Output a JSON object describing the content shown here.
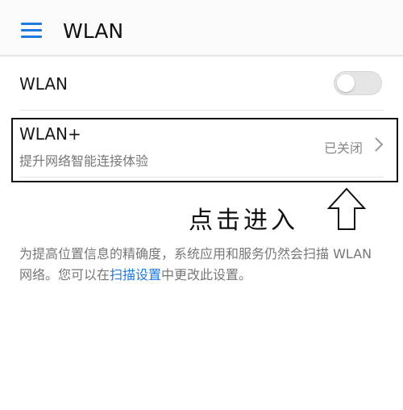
{
  "header": {
    "title": "WLAN",
    "menu_icon": "hamburger-menu-icon",
    "accent_color": "#1f7ae0"
  },
  "wlan_row": {
    "label": "WLAN",
    "toggle_state": "off"
  },
  "wlan_plus_row": {
    "title": "WLAN+",
    "subtitle": "提升网络智能连接体验",
    "status": "已关闭",
    "chevron_icon": "chevron-right-icon"
  },
  "annotation": {
    "text": "点击进入",
    "arrow_icon": "up-arrow-icon"
  },
  "info": {
    "text_before": "为提高位置信息的精确度，系统应用和服务仍然会扫描 WLAN 网络。您可以在",
    "link": "扫描设置",
    "text_after": "中更改此设置。"
  }
}
